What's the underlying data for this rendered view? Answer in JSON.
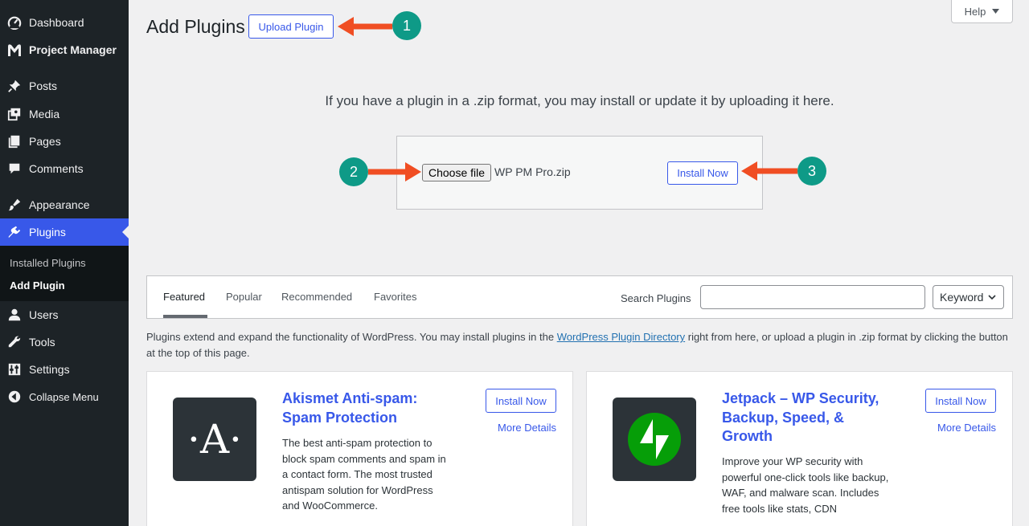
{
  "sidebar": {
    "items": [
      {
        "label": "Dashboard",
        "icon": "dashboard-icon"
      },
      {
        "label": "Project Manager",
        "icon": "project-manager-icon"
      },
      {
        "label": "Posts",
        "icon": "pin-icon"
      },
      {
        "label": "Media",
        "icon": "media-icon"
      },
      {
        "label": "Pages",
        "icon": "pages-icon"
      },
      {
        "label": "Comments",
        "icon": "comment-icon"
      },
      {
        "label": "Appearance",
        "icon": "brush-icon"
      },
      {
        "label": "Plugins",
        "icon": "plug-icon"
      },
      {
        "label": "Users",
        "icon": "user-icon"
      },
      {
        "label": "Tools",
        "icon": "wrench-icon"
      },
      {
        "label": "Settings",
        "icon": "settings-icon"
      },
      {
        "label": "Collapse Menu",
        "icon": "collapse-icon"
      }
    ],
    "submenu": [
      "Installed Plugins",
      "Add Plugin"
    ]
  },
  "header": {
    "title": "Add Plugins",
    "upload_button": "Upload Plugin",
    "help": "Help"
  },
  "upload": {
    "description": "If you have a plugin in a .zip format, you may install or update it by uploading it here.",
    "choose_file": "Choose file",
    "file_name": "WP PM Pro.zip",
    "install_now": "Install Now"
  },
  "annotations": [
    "1",
    "2",
    "3"
  ],
  "tabs": [
    "Featured",
    "Popular",
    "Recommended",
    "Favorites"
  ],
  "search": {
    "label": "Search Plugins",
    "value": "",
    "type_select": "Keyword"
  },
  "intro": {
    "before_link": "Plugins extend and expand the functionality of WordPress. You may install plugins in the ",
    "link": "WordPress Plugin Directory",
    "after_link": " right from here, or upload a plugin in .zip format by clicking the button at the top of this page."
  },
  "cards": [
    {
      "title": "Akismet Anti-spam: Spam Protection",
      "description": "The best anti-spam protection to block spam comments and spam in a contact form. The most trusted antispam solution for WordPress and WooCommerce.",
      "install": "Install Now",
      "more": "More Details",
      "icon_letter": "·A·"
    },
    {
      "title": "Jetpack – WP Security, Backup, Speed, & Growth",
      "description": "Improve your WP security with powerful one-click tools like backup, WAF, and malware scan. Includes free tools like stats, CDN",
      "install": "Install Now",
      "more": "More Details"
    }
  ],
  "colors": {
    "sidebar_bg": "#1d2327",
    "active_menu": "#3858e9",
    "link": "#3858e9",
    "annotation_arrow": "#f04e23",
    "annotation_circle": "#0e9a87",
    "jetpack_green": "#069e08"
  }
}
